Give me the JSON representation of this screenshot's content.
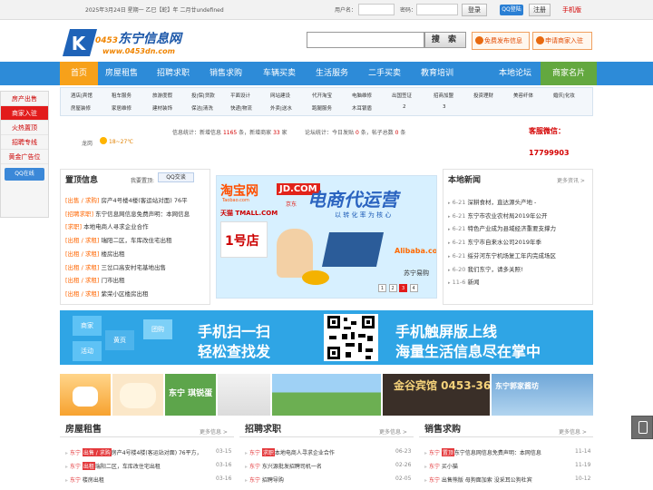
{
  "topbar": {
    "date": "2025年3月24日 星期一  乙巳【蛇】年 二月廿undefined",
    "username_label": "用户名：",
    "password_label": "密码：",
    "login": "登录",
    "qq_login": "QQ登陆",
    "register": "注册",
    "mobile": "手机版"
  },
  "logo": {
    "mark": "K",
    "prefix": "0453",
    "title": "东宁信息网",
    "url": "www.0453dn.com"
  },
  "search": {
    "button": "搜 索",
    "placeholder": ""
  },
  "header_buttons": [
    "免费发布信息",
    "申请商家入驻"
  ],
  "nav": [
    "首页",
    "房屋租售",
    "招聘求职",
    "销售求购",
    "车辆买卖",
    "生活服务",
    "二手买卖",
    "教育培训",
    "本地论坛",
    "商家名片"
  ],
  "categories": {
    "row1": [
      "酒店|宾馆",
      "租车服务",
      "旅游度假",
      "投|保|贷款",
      "平面设计",
      "网站建设",
      "代开淘宝",
      "电脑维修",
      "出国签证",
      "招商加盟",
      "投资理财",
      "美容纤体",
      "婚庆|化妆"
    ],
    "row2": [
      "房屋装修",
      "家居维修",
      "建材装饰",
      "保洁|清洗",
      "快递|物流",
      "外卖|送水",
      "跑腿服务",
      "木耳银盾",
      "2",
      "3"
    ]
  },
  "sidebar": [
    "房产出售",
    "商家入驻",
    "火热置顶",
    "招聘专线",
    "黄金广告位",
    "QQ在线"
  ],
  "stats": {
    "info_label": "信息统计：新增信息",
    "info_count": "1165",
    "info_unit": "条，新增商家",
    "shop_count": "33",
    "shop_unit": "家",
    "forum_label": "论坛统计：今日发贴",
    "forum_today": "0",
    "forum_mid": "条，帖子总数",
    "forum_total": "0",
    "forum_unit": "条",
    "weather_city": "龙岗",
    "weather_temp": "18~27℃",
    "service_label": "客服微信：",
    "service_number": "17799903"
  },
  "top_info": {
    "title": "置顶信息",
    "wanted_label": "我要置顶:",
    "qq": "QQ交谈",
    "items": [
      {
        "tag": "[出售 / 求购]",
        "text": "房产4号楼4楼(客运站对面) 76平"
      },
      {
        "tag": "[招聘求职]",
        "text": "东宁信息网信息免费声明：本网信息"
      },
      {
        "tag": "[求职]",
        "text": "本地电商人寻求企业合作"
      },
      {
        "tag": "[出租 / 求租]",
        "text": "瑞阳二区，车库改住宅出租"
      },
      {
        "tag": "[出租 / 求租]",
        "text": "楼房出租"
      },
      {
        "tag": "[出租 / 求租]",
        "text": "三岔口高安村宅基地出售"
      },
      {
        "tag": "[出租 / 求租]",
        "text": "门市出租"
      },
      {
        "tag": "[出租 / 求租]",
        "text": "紫荣小区楼房出租"
      }
    ]
  },
  "banner": {
    "taobao": "淘宝网",
    "taobao_url": "Taobao.com",
    "jd": "JD.COM",
    "jd_cn": "京东",
    "tmall": "天猫 TMALL.COM",
    "yhd": "1号店",
    "headline": "电商代运营",
    "sub": "以 转 化 率 为 核 心",
    "alibaba": "Alibaba.com",
    "suning": "苏宁易购",
    "dots": [
      "1",
      "2",
      "3",
      "4"
    ]
  },
  "news": {
    "title": "本地新闻",
    "more": "更多资讯 >",
    "items": [
      {
        "date": "6-21",
        "text": "深耕食材，直达源头产地 -"
      },
      {
        "date": "6-21",
        "text": "东宁市农业农村局2019年公开"
      },
      {
        "date": "6-21",
        "text": "特色产业成为县域经济重要支撑力"
      },
      {
        "date": "6-21",
        "text": "东宁市自来水公司2019年季"
      },
      {
        "date": "6-21",
        "text": "绥芬河东宁机场复工年内完成场区"
      },
      {
        "date": "6-20",
        "text": "我们东宁，请多关照!"
      },
      {
        "date": "11-6",
        "text": "新闻"
      }
    ]
  },
  "ad": {
    "line1": "手机扫一扫",
    "line2": "轻松查找发",
    "line3": "手机触屏版上线",
    "line4": "海量生活信息尽在掌中",
    "hexes": [
      "商家",
      "黄页",
      "活动",
      "团购"
    ]
  },
  "thumbs": [
    {
      "label": ""
    },
    {
      "label": "东宁 琪锐蛋"
    },
    {
      "label": ""
    },
    {
      "label": ""
    },
    {
      "label": "金谷宾馆 0453-3636000"
    },
    {
      "label": "东宁郭家酱坊"
    }
  ],
  "sections": [
    {
      "title": "房屋租售",
      "more": "更多信息 >",
      "rows": [
        {
          "prefix": "东宁",
          "tag": "出售 / 求购",
          "text": "房产4号楼4楼(客运站对面) 76平方，",
          "date": "03-15"
        },
        {
          "prefix": "东宁",
          "tag": "出租",
          "text": "瑞阳二区，车库改住宅出租",
          "date": "03-16"
        },
        {
          "prefix": "东宁",
          "tag": "",
          "text": "楼房出租",
          "date": "03-16"
        }
      ]
    },
    {
      "title": "招聘求职",
      "more": "更多信息 >",
      "rows": [
        {
          "prefix": "东宁",
          "tag": "求职",
          "text": "本地电商人寻求企业合作",
          "date": "06-23"
        },
        {
          "prefix": "东宁",
          "tag": "",
          "text": "东兴源批发招聘司机一名",
          "date": "02-26"
        },
        {
          "prefix": "东宁",
          "tag": "",
          "text": "招聘导购",
          "date": "02-05"
        }
      ]
    },
    {
      "title": "销售求购",
      "more": "更多信息 >",
      "rows": [
        {
          "prefix": "东宁",
          "tag": "置顶",
          "text": "东宁信息网信息免费声明：本网信息",
          "date": "11-14"
        },
        {
          "prefix": "东宁",
          "tag": "",
          "text": "买小猫",
          "date": "11-19"
        },
        {
          "prefix": "东宁",
          "tag": "",
          "text": "出售熊版 母狗面加索 没采耳公狗杜宾",
          "date": "10-12"
        }
      ]
    }
  ],
  "colors": {
    "nav": "#2d8bd8",
    "home": "#f7a11a",
    "biz": "#63a83f",
    "accent_red": "#e21b1b",
    "tag_orange": "#ff6600"
  }
}
